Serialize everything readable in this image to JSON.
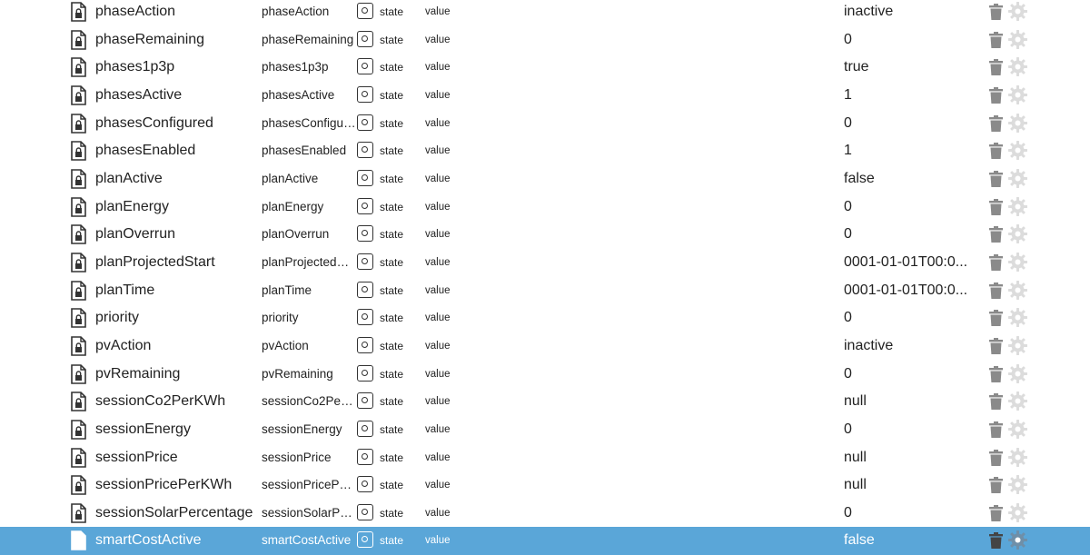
{
  "colors": {
    "selected_row": "#5aa6d8",
    "icon_gray": "#888888",
    "gear_gray": "#dcdcdc"
  },
  "icons": {
    "file": "lock-file-icon",
    "type": "state-icon",
    "delete": "trash-icon",
    "settings": "gear-icon"
  },
  "rows": [
    {
      "name": "phaseAction",
      "id": "phaseAction",
      "role": "state",
      "value_label": "value",
      "value": "inactive"
    },
    {
      "name": "phaseRemaining",
      "id": "phaseRemaining",
      "role": "state",
      "value_label": "value",
      "value": "0"
    },
    {
      "name": "phases1p3p",
      "id": "phases1p3p",
      "role": "state",
      "value_label": "value",
      "value": "true"
    },
    {
      "name": "phasesActive",
      "id": "phasesActive",
      "role": "state",
      "value_label": "value",
      "value": "1"
    },
    {
      "name": "phasesConfigured",
      "id": "phasesConfigur...",
      "role": "state",
      "value_label": "value",
      "value": "0"
    },
    {
      "name": "phasesEnabled",
      "id": "phasesEnabled",
      "role": "state",
      "value_label": "value",
      "value": "1"
    },
    {
      "name": "planActive",
      "id": "planActive",
      "role": "state",
      "value_label": "value",
      "value": "false"
    },
    {
      "name": "planEnergy",
      "id": "planEnergy",
      "role": "state",
      "value_label": "value",
      "value": "0"
    },
    {
      "name": "planOverrun",
      "id": "planOverrun",
      "role": "state",
      "value_label": "value",
      "value": "0"
    },
    {
      "name": "planProjectedStart",
      "id": "planProjectedSt...",
      "role": "state",
      "value_label": "value",
      "value": "0001-01-01T00:0..."
    },
    {
      "name": "planTime",
      "id": "planTime",
      "role": "state",
      "value_label": "value",
      "value": "0001-01-01T00:0..."
    },
    {
      "name": "priority",
      "id": "priority",
      "role": "state",
      "value_label": "value",
      "value": "0"
    },
    {
      "name": "pvAction",
      "id": "pvAction",
      "role": "state",
      "value_label": "value",
      "value": "inactive"
    },
    {
      "name": "pvRemaining",
      "id": "pvRemaining",
      "role": "state",
      "value_label": "value",
      "value": "0"
    },
    {
      "name": "sessionCo2PerKWh",
      "id": "sessionCo2PerK...",
      "role": "state",
      "value_label": "value",
      "value": "null"
    },
    {
      "name": "sessionEnergy",
      "id": "sessionEnergy",
      "role": "state",
      "value_label": "value",
      "value": "0"
    },
    {
      "name": "sessionPrice",
      "id": "sessionPrice",
      "role": "state",
      "value_label": "value",
      "value": "null"
    },
    {
      "name": "sessionPricePerKWh",
      "id": "sessionPricePer...",
      "role": "state",
      "value_label": "value",
      "value": "null"
    },
    {
      "name": "sessionSolarPercentage",
      "id": "sessionSolarPer...",
      "role": "state",
      "value_label": "value",
      "value": "0"
    },
    {
      "name": "smartCostActive",
      "id": "smartCostActive",
      "role": "state",
      "value_label": "value",
      "value": "false",
      "selected": true
    }
  ]
}
